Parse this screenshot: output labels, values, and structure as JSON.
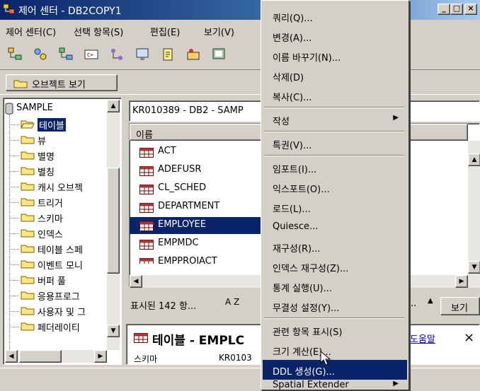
{
  "window": {
    "title": "제어 센터 - DB2COPY1",
    "minimize": "_",
    "maximize": "□",
    "close": "×"
  },
  "menubar": {
    "items": [
      "제어 센터(C)",
      "선택 항목(S)",
      "편집(E)",
      "보기(V)"
    ]
  },
  "viewbar": {
    "object_view": "오브젝트 보기"
  },
  "tree": {
    "root": "SAMPLE",
    "items": [
      "테이블",
      "뷰",
      "별명",
      "별칭",
      "캐시 오브젝",
      "트리거",
      "스키마",
      "인덱스",
      "테이블 스페",
      "이벤트 모니",
      "버퍼 풀",
      "응용프로그",
      "사용자 및 그",
      "페더레이티"
    ],
    "selected_index": 0
  },
  "content": {
    "breadcrumb": "KR010389 - DB2 - SAMP",
    "column_header": "이름",
    "rows": [
      "ACT",
      "ADEFUSR",
      "CL_SCHED",
      "DEPARTMENT",
      "EMPLOYEE",
      "EMPMDC",
      "EMPPROJACT"
    ],
    "selected_row": "EMPLOYEE",
    "status_count": "표시된 142 항...",
    "sort_icon_label": "A Z",
    "ellipsis": "...",
    "view_button": "보기"
  },
  "detail": {
    "title": "테이블 - EMPLC",
    "help": "도움말",
    "close": "×",
    "schema_label": "스키마",
    "schema_value": "KR0103"
  },
  "context_menu": {
    "items": [
      {
        "label": "쿼리(Q)...",
        "submenu": false
      },
      {
        "label": "변경(A)...",
        "submenu": false
      },
      {
        "label": "이름 바꾸기(N)...",
        "submenu": false
      },
      {
        "label": "삭제(D)",
        "submenu": false
      },
      {
        "label": "복사(C)...",
        "submenu": false
      },
      {
        "label": "작성",
        "submenu": true
      },
      {
        "label": "특권(V)...",
        "submenu": false
      },
      {
        "label": "임포트(I)...",
        "submenu": false
      },
      {
        "label": "익스포트(O)...",
        "submenu": false
      },
      {
        "label": "로드(L)...",
        "submenu": false
      },
      {
        "label": "Quiesce...",
        "submenu": false
      },
      {
        "label": "재구성(R)...",
        "submenu": false
      },
      {
        "label": "인덱스 재구성(Z)...",
        "submenu": false
      },
      {
        "label": "통계 실행(U)...",
        "submenu": false
      },
      {
        "label": "무결성 설정(Y)...",
        "submenu": false
      },
      {
        "label": "관련 항목 표시(S)",
        "submenu": false
      },
      {
        "label": "크기 계산(E)...",
        "submenu": false
      },
      {
        "label": "DDL 생성(G)...",
        "submenu": false,
        "highlighted": true
      },
      {
        "label": "Spatial Extender",
        "submenu": true
      }
    ]
  },
  "colors": {
    "title_gradient_start": "#0a246a",
    "selection": "#0a246a",
    "face": "#d4d0c8",
    "link": "#0000cc"
  }
}
